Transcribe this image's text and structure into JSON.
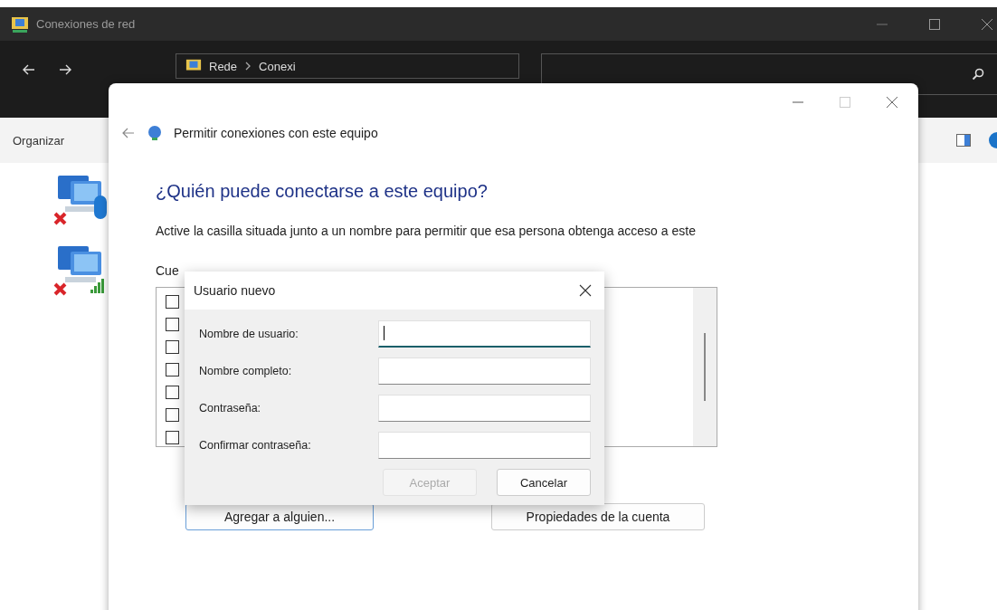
{
  "explorer": {
    "title": "Conexiones de red",
    "address": [
      "Rede",
      "Conexi"
    ],
    "toolbar": {
      "organize": "Organizar"
    },
    "connections": [
      {
        "kind": "bluetooth",
        "disconnected": true
      },
      {
        "kind": "signal",
        "disconnected": true
      }
    ]
  },
  "dialog": {
    "title": "Permitir conexiones con este equipo",
    "heading": "¿Quién puede conectarse a este equipo?",
    "description": "Active la casilla situada junto a un nombre para permitir que esa persona obtenga acceso a este",
    "list_label": "Cue",
    "accounts": [
      {
        "checked": false
      },
      {
        "checked": false
      },
      {
        "checked": false
      },
      {
        "checked": false
      },
      {
        "checked": false
      },
      {
        "checked": false
      },
      {
        "checked": false
      }
    ],
    "buttons": [
      "Agregar a alguien...",
      "Propiedades de la cuenta"
    ]
  },
  "new_user": {
    "title": "Usuario nuevo",
    "fields": [
      {
        "label": "Nombre de usuario:",
        "focused": true
      },
      {
        "label": "Nombre completo:",
        "focused": false
      },
      {
        "label": "Contraseña:",
        "focused": false
      },
      {
        "label": "Confirmar contraseña:",
        "focused": false
      }
    ],
    "buttons": [
      {
        "label": "Aceptar",
        "disabled": true
      },
      {
        "label": "Cancelar",
        "disabled": false
      }
    ]
  }
}
